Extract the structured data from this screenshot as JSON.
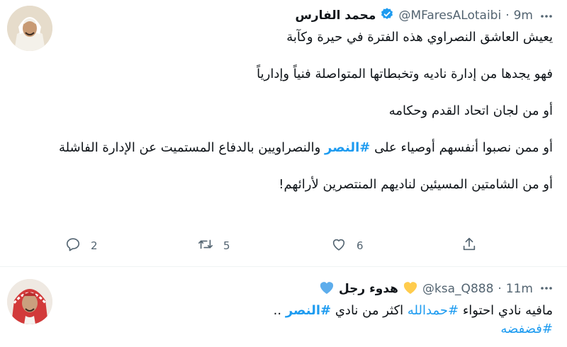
{
  "tweet": {
    "display_name": "محمد الفارس",
    "handle": "@MFaresALotaibi",
    "dot": "·",
    "time": "9m",
    "paragraphs": [
      "يعيش العاشق النصراوي هذه الفترة في حيرة وكآبة",
      "فهو يجدها من إدارة ناديه وتخبطاتها المتواصلة فنياً وإدارياً",
      "أو من لجان اتحاد القدم وحكامه",
      "أو ممن نصبوا أنفسهم أوصياء على",
      "والنصراويين بالدفاع المستميت عن الإدارة الفاشلة",
      "أو من الشامتين المسيئين لناديهم المنتصرين لأرائهم!"
    ],
    "hashtag": "#النصر",
    "replies": "2",
    "retweets": "5",
    "likes": "6"
  },
  "reply": {
    "display_name": "هدوء رجل",
    "handle": "@ksa_Q888",
    "dot": "·",
    "time": "11m",
    "text_start": "مافيه نادي احتواء",
    "hashtag_1": "#حمدالله",
    "text_mid": "اكثر من نادي",
    "hashtag_2": "#النصر",
    "text_end": "..",
    "hashtag_3": "#فضفضه"
  },
  "colors": {
    "accent": "#1d9bf0",
    "text": "#0f1419",
    "muted": "#536471",
    "heart_yellow": "#ffcc4d",
    "heart_blue": "#5dadec"
  },
  "icons": {
    "verified": "verified-badge-icon",
    "more": "more-horizontal-icon",
    "reply": "reply-bubble-icon",
    "retweet": "retweet-icon",
    "like": "heart-outline-icon",
    "share": "share-upload-icon"
  }
}
